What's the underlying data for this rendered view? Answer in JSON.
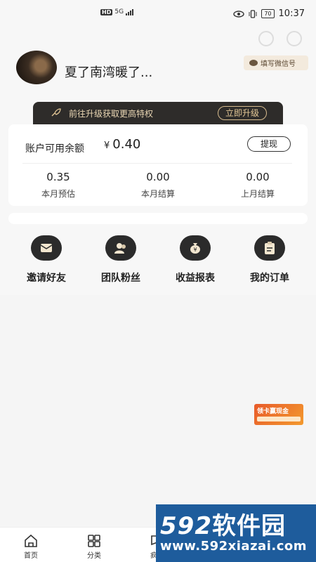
{
  "status_bar": {
    "hd": "HD",
    "net": "5G",
    "battery": "70",
    "time": "10:37"
  },
  "header": {
    "username": "夏了南湾暖了...",
    "wechat_button": "填写微信号"
  },
  "upgrade_banner": {
    "text": "前往升级获取更高特权",
    "button": "立即升级"
  },
  "balance": {
    "label": "账户可用余额",
    "currency": "¥",
    "amount": "0.40",
    "withdraw": "提现",
    "stats": [
      {
        "value": "0.35",
        "label": "本月预估"
      },
      {
        "value": "0.00",
        "label": "本月结算"
      },
      {
        "value": "0.00",
        "label": "上月结算"
      }
    ]
  },
  "menu": [
    {
      "label": "邀请好友",
      "icon": "envelope-icon"
    },
    {
      "label": "团队粉丝",
      "icon": "people-icon"
    },
    {
      "label": "收益报表",
      "icon": "money-bag-icon"
    },
    {
      "label": "我的订单",
      "icon": "clipboard-icon"
    }
  ],
  "promo": {
    "line1": "领卡赢现金"
  },
  "bottom_nav": [
    {
      "label": "首页",
      "icon": "home-icon"
    },
    {
      "label": "分类",
      "icon": "grid-icon"
    },
    {
      "label": "疯抢",
      "icon": "flag-icon"
    }
  ],
  "watermark": {
    "brand_num": "592",
    "brand_cn": "软件园",
    "url": "www.592xiazai.com"
  }
}
